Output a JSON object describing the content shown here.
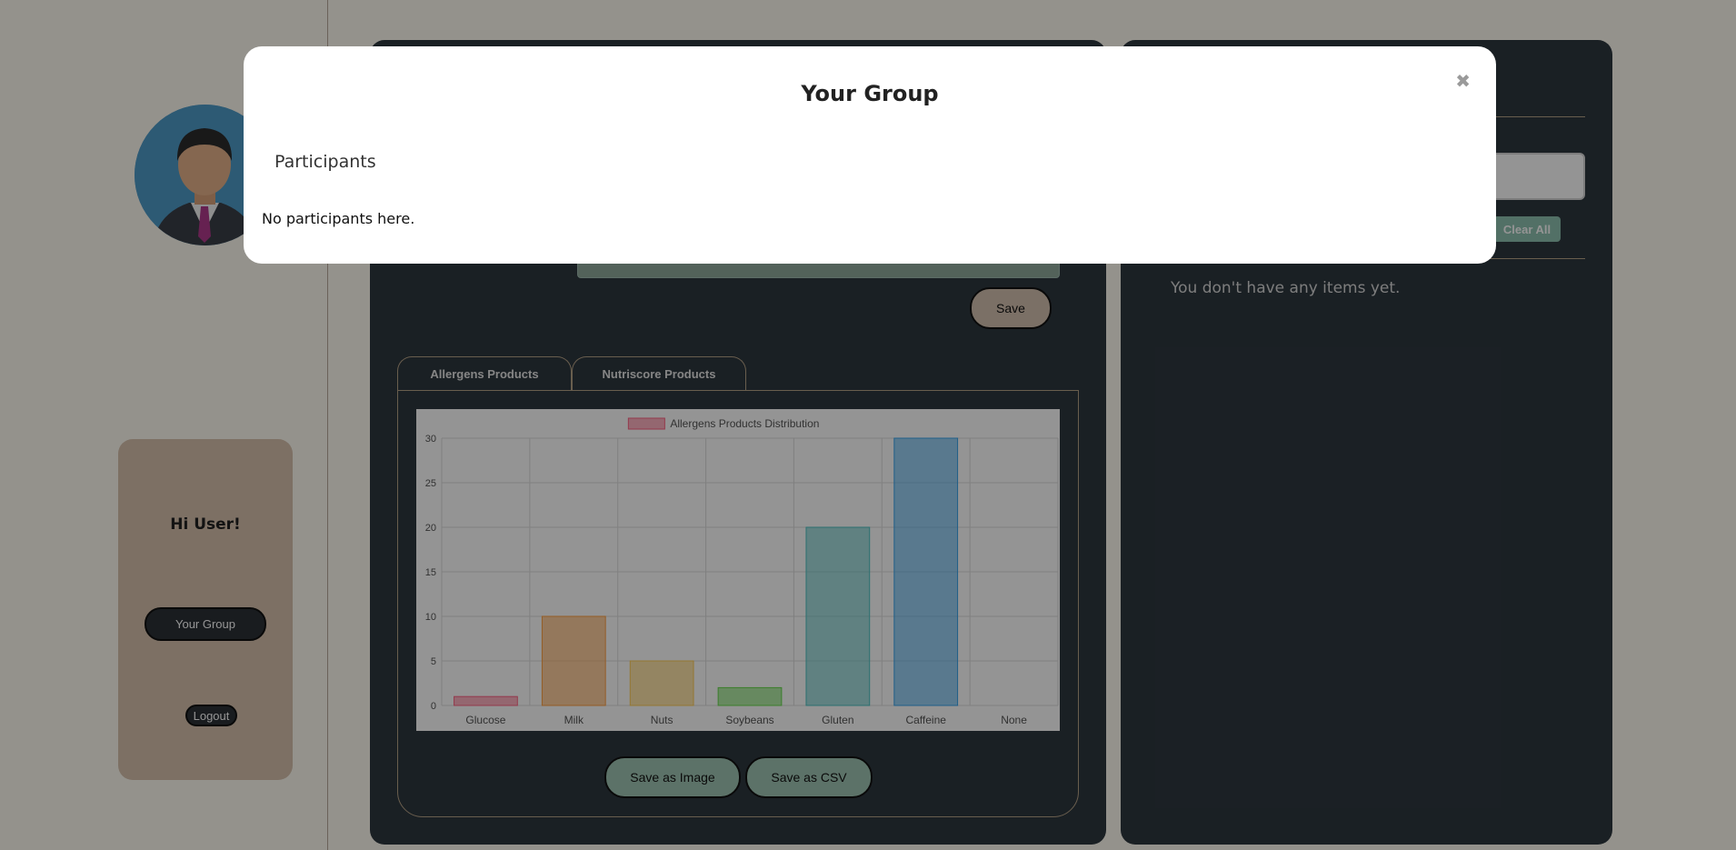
{
  "sidebar": {
    "greeting": "Hi User!",
    "group_button": "Your Group",
    "logout_button": "Logout"
  },
  "center": {
    "save_button": "Save",
    "tabs": [
      {
        "label": "Allergens Products"
      },
      {
        "label": "Nutriscore Products"
      }
    ],
    "save_image_button": "Save as Image",
    "save_csv_button": "Save as CSV"
  },
  "right": {
    "clear_all_button": "Clear All",
    "empty_message": "You don't have any items yet."
  },
  "modal": {
    "title": "Your Group",
    "close_glyph": "✖",
    "section_title": "Participants",
    "empty_message": "No participants here."
  },
  "chart_data": {
    "type": "bar",
    "categories": [
      "Glucose",
      "Milk",
      "Nuts",
      "Soybeans",
      "Gluten",
      "Caffeine",
      "None"
    ],
    "series": [
      {
        "name": "Allergens Products Distribution",
        "values": [
          1,
          10,
          5,
          2,
          20,
          30,
          0
        ]
      }
    ],
    "colors": [
      "#ff6384",
      "#ff9f40",
      "#ffcd56",
      "#4bc0c0",
      "#36a2eb",
      "#66d94d"
    ],
    "bar_colors": [
      "#ff6384",
      "#ff9f40",
      "#ffcd56",
      "#66d94d",
      "#4bc0c0",
      "#36a2eb",
      "#9966ff"
    ],
    "legend_color": "#ff6384",
    "yticks": [
      "0",
      "5",
      "10",
      "15",
      "20",
      "25",
      "30"
    ],
    "ylim": [
      0,
      30
    ],
    "grid": true,
    "legend_position": "top"
  }
}
